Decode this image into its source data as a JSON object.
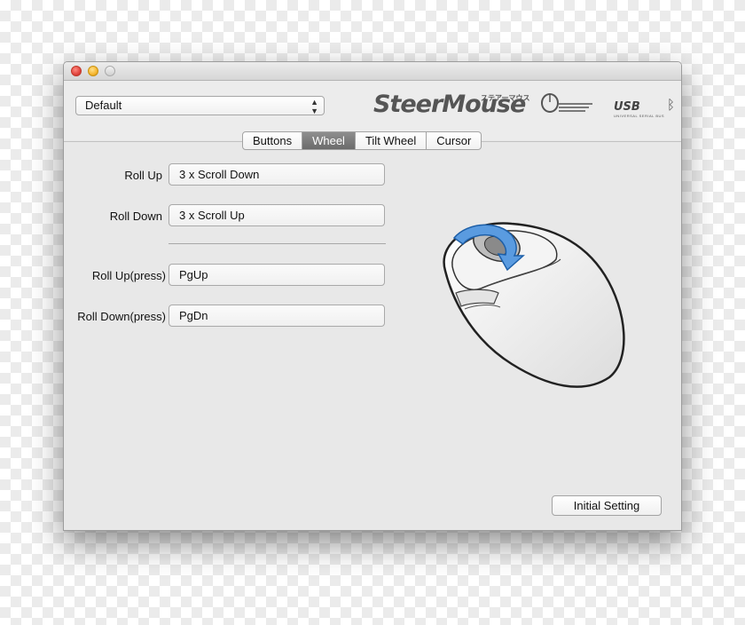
{
  "window": {
    "traffic_lights": [
      "close",
      "minimize",
      "maximize"
    ]
  },
  "toolbar": {
    "profile_value": "Default",
    "logo_text": "SteerMouse",
    "logo_kana": "ステアーマウス",
    "usb_text": "USB",
    "usb_sub": "UNIVERSAL SERIAL BUS"
  },
  "tabs": [
    {
      "label": "Buttons",
      "selected": false
    },
    {
      "label": "Wheel",
      "selected": true
    },
    {
      "label": "Tilt Wheel",
      "selected": false
    },
    {
      "label": "Cursor",
      "selected": false
    }
  ],
  "wheel": {
    "roll_up": {
      "label": "Roll Up",
      "value": "3 x Scroll Down"
    },
    "roll_down": {
      "label": "Roll Down",
      "value": "3 x Scroll Up"
    },
    "roll_up_press": {
      "label": "Roll Up(press)",
      "value": "PgUp"
    },
    "roll_down_press": {
      "label": "Roll Down(press)",
      "value": "PgDn"
    }
  },
  "buttons": {
    "initial_setting": "Initial Setting"
  },
  "colors": {
    "selected_tab": "#7a7a7a",
    "arrow_blue": "#4a90d9"
  },
  "icons": [
    "close-icon",
    "minimize-icon",
    "zoom-icon",
    "popup-arrows-icon",
    "steermouse-logo-icon",
    "bluetooth-icon",
    "mouse-wheel-illustration"
  ]
}
